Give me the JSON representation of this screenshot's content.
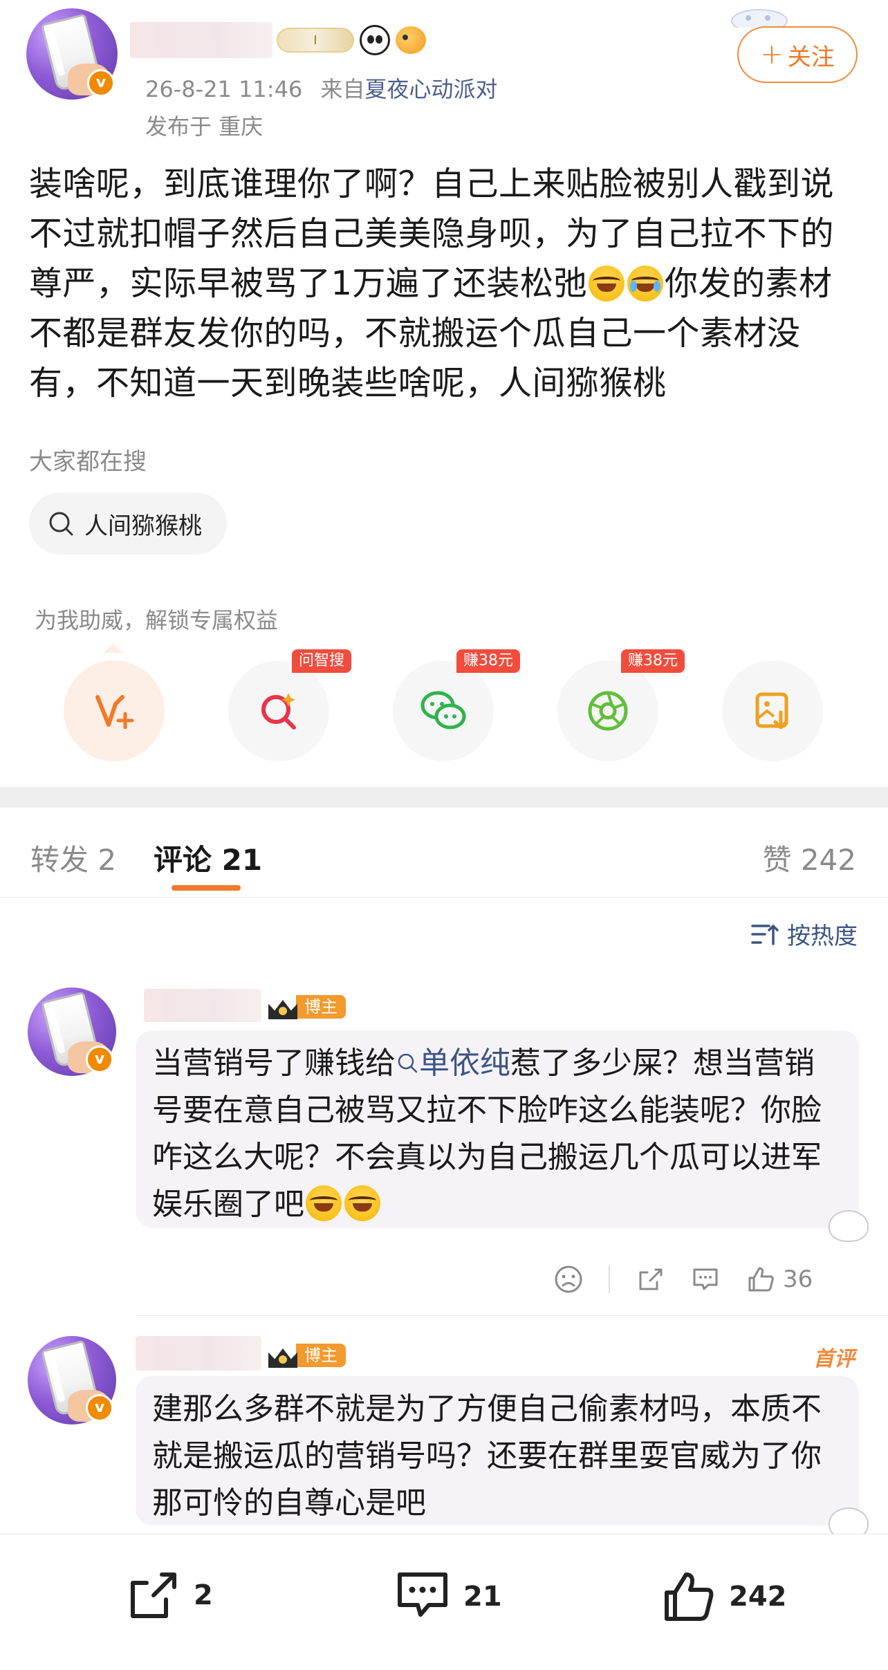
{
  "post": {
    "timestamp": "26-8-21 11:46",
    "source_prefix": "来自",
    "source_name": "夏夜心动派对",
    "location": "发布于 重庆",
    "follow_label": "关注",
    "follow_plus": "+",
    "level_badge": "I",
    "text_before_emoji": "装啥呢，到底谁理你了啊？自己上来贴脸被别人戳到说不过就扣帽子然后自己美美隐身呗，为了自己拉不下的尊严，实际早被骂了1万遍了还装松弛",
    "text_after_emoji": "你发的素材不都是群友发你的吗，不就搬运个瓜自己一个素材没有，不知道一天到晚装些啥呢，人间猕猴桃",
    "verified_mark": "v"
  },
  "search": {
    "title": "大家都在搜",
    "chip_label": "人间猕猴桃"
  },
  "boost": {
    "title": "为我助威，解锁专属权益",
    "items": [
      {
        "icon": "vip-plus-icon",
        "tag": ""
      },
      {
        "icon": "ai-search-icon",
        "tag": "问智搜"
      },
      {
        "icon": "wechat-icon",
        "tag": "赚38元"
      },
      {
        "icon": "moments-icon",
        "tag": "赚38元"
      },
      {
        "icon": "save-image-icon",
        "tag": ""
      }
    ]
  },
  "tabs": {
    "repost": "转发 2",
    "comments": "评论 21",
    "likes": "赞 242"
  },
  "sort": {
    "label": "按热度"
  },
  "comments": [
    {
      "badge": "博主",
      "text_before_link": "当营销号了赚钱给",
      "link_text": "单依纯",
      "text_after_link": "惹了多少屎？想当营销号要在意自己被骂又拉不下脸咋这么能装呢？你脸咋这么大呢？不会真以为自己搬运几个瓜可以进军娱乐圈了吧",
      "likes": "36"
    },
    {
      "badge": "博主",
      "first_label": "首评",
      "text": "建那么多群不就是为了方便自己偷素材吗，本质不就是搬运瓜的营销号吗？还要在群里耍官威为了你那可怜的自尊心是吧"
    }
  ],
  "bottom_bar": {
    "repost_count": "2",
    "comment_count": "21",
    "like_count": "242"
  },
  "colors": {
    "accent_orange": "#f07a2a",
    "link_blue": "#3d5585",
    "tag_red": "#f24c3d",
    "blogger_orange": "#f29a2e"
  }
}
